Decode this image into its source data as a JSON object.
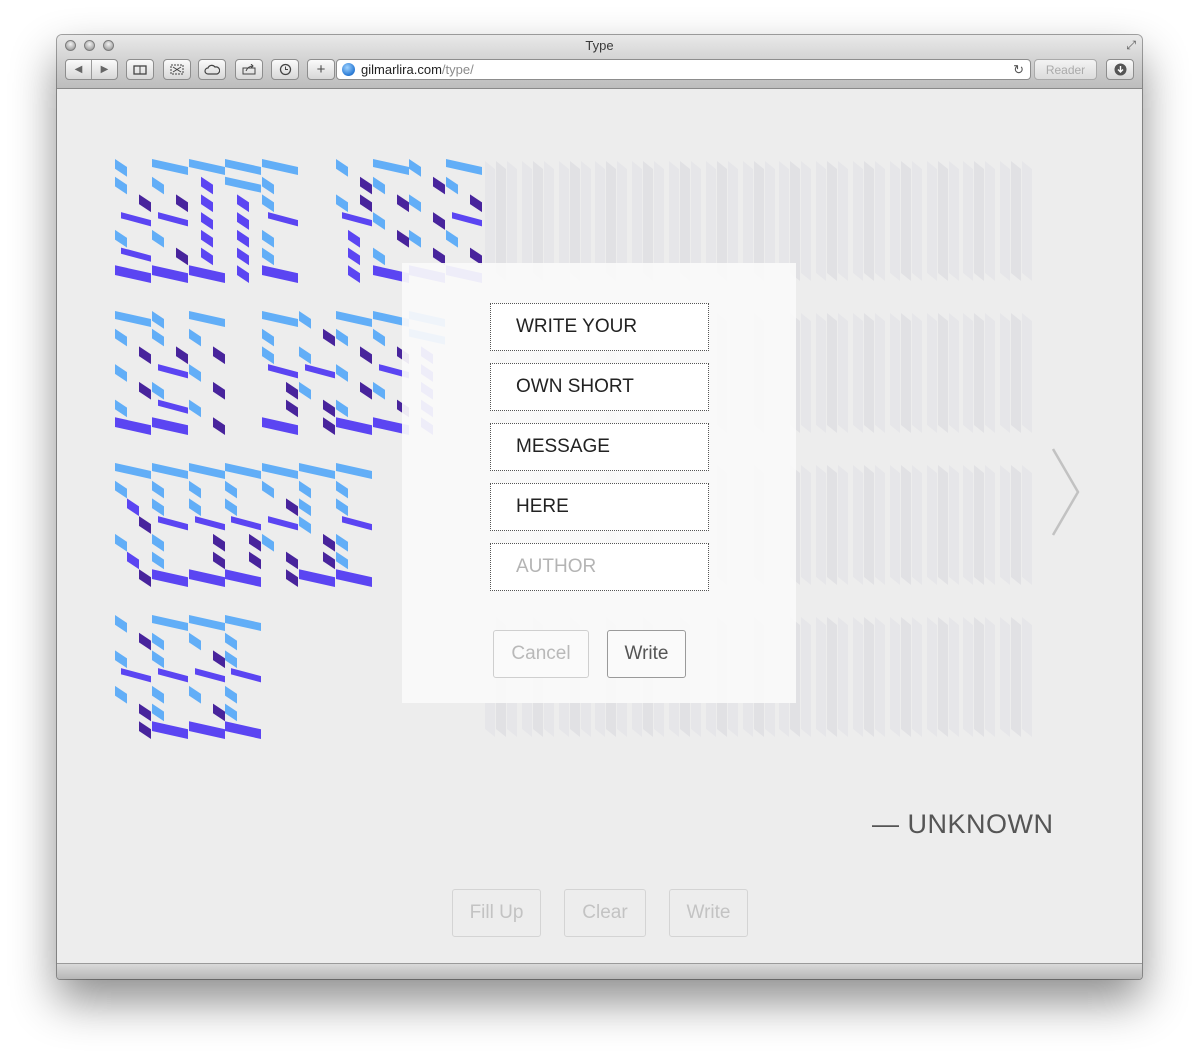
{
  "window": {
    "title": "Type"
  },
  "toolbar": {
    "url_domain": "gilmarlira.com",
    "url_path": "/type/",
    "reader_label": "Reader",
    "back_icon": "◀",
    "forward_icon": "▶",
    "add_icon": "+",
    "reload_icon": "↻"
  },
  "poster": {
    "lines": [
      "WRITE YOUR",
      "OWN SHORT",
      "MESSAGE",
      "HERE"
    ],
    "author": "— UNKNOWN",
    "colors": {
      "light": "#62aef7",
      "mid": "#5b45f2",
      "dark": "#48249c",
      "ghost": "#d8d8de"
    }
  },
  "dialog": {
    "lines": [
      {
        "value": "WRITE YOUR"
      },
      {
        "value": "OWN SHORT"
      },
      {
        "value": "MESSAGE"
      },
      {
        "value": "HERE"
      }
    ],
    "author_placeholder": "AUTHOR",
    "author_value": "",
    "cancel_label": "Cancel",
    "write_label": "Write"
  },
  "actions": {
    "fill_up_label": "Fill Up",
    "clear_label": "Clear",
    "write_label": "Write"
  }
}
